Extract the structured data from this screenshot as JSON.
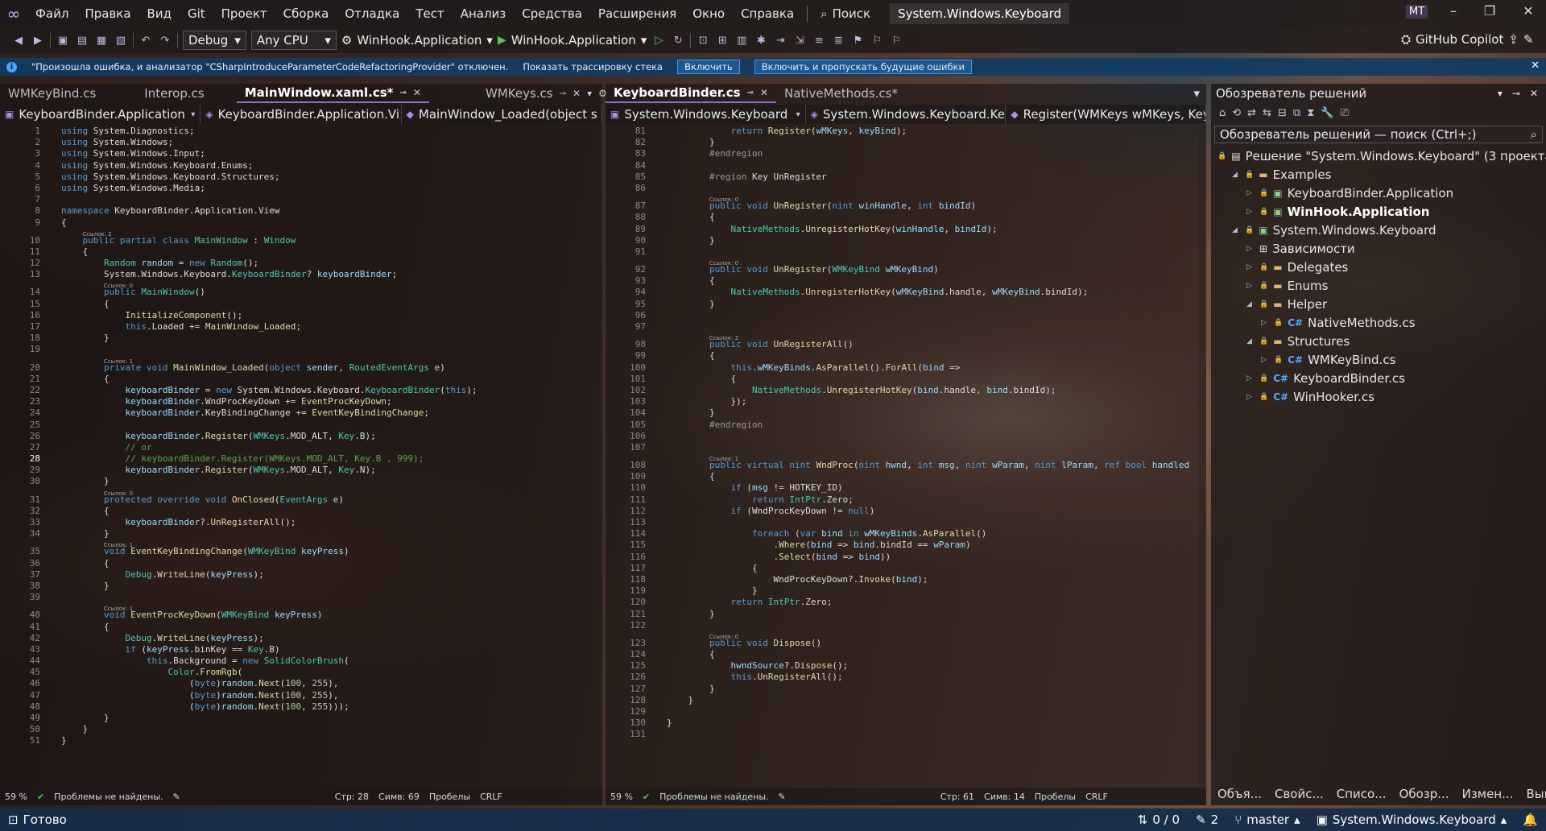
{
  "menu": {
    "items": [
      "Файл",
      "Правка",
      "Вид",
      "Git",
      "Проект",
      "Сборка",
      "Отладка",
      "Тест",
      "Анализ",
      "Средства",
      "Расширения",
      "Окно",
      "Справка"
    ],
    "search_label": "Поиск",
    "window_title": "System.Windows.Keyboard",
    "avatar": "MT"
  },
  "toolbar": {
    "config": "Debug",
    "platform": "Any CPU",
    "startup_project": "WinHook.Application",
    "run_target": "WinHook.Application",
    "copilot": "GitHub Copilot"
  },
  "infobar": {
    "message": "\"Произошла ошибка, и анализатор \"CSharpIntroduceParameterCodeRefactoringProvider\" отключен.",
    "show_stack": "Показать трассировку стека",
    "enable": "Включить",
    "enable_ignore": "Включить и пропускать будущие ошибки"
  },
  "left_pane": {
    "tabs": [
      "WMKeyBind.cs",
      "Interop.cs",
      "MainWindow.xaml.cs*",
      "WMKeys.cs"
    ],
    "nav": [
      "KeyboardBinder.Application",
      "KeyboardBinder.Application.Vi",
      "MainWindow_Loaded(object s"
    ],
    "status": {
      "zoom": "59 %",
      "problems": "Проблемы не найдены.",
      "line": "Стр: 28",
      "col": "Симв: 69",
      "spaces": "Пробелы",
      "eol": "CRLF"
    }
  },
  "right_pane": {
    "tabs": [
      "KeyboardBinder.cs",
      "NativeMethods.cs*"
    ],
    "nav": [
      "System.Windows.Keyboard",
      "System.Windows.Keyboard.Key",
      "Register(WMKeys wMKeys, Key"
    ],
    "status": {
      "zoom": "59 %",
      "problems": "Проблемы не найдены.",
      "line": "Стр: 61",
      "col": "Симв: 14",
      "spaces": "Пробелы",
      "eol": "CRLF"
    }
  },
  "solution_explorer": {
    "title": "Обозреватель решений",
    "search_placeholder": "Обозреватель решений — поиск (Ctrl+;)",
    "solution": "Решение \"System.Windows.Keyboard\" (3 проекта 3)",
    "nodes": [
      {
        "label": "Examples",
        "indent": 1,
        "kind": "folder",
        "arrow": "open"
      },
      {
        "label": "KeyboardBinder.Application",
        "indent": 2,
        "kind": "project",
        "arrow": "closed"
      },
      {
        "label": "WinHook.Application",
        "indent": 2,
        "kind": "project",
        "arrow": "closed",
        "bold": true
      },
      {
        "label": "System.Windows.Keyboard",
        "indent": 1,
        "kind": "project",
        "arrow": "open"
      },
      {
        "label": "Зависимости",
        "indent": 2,
        "kind": "deps",
        "arrow": "closed"
      },
      {
        "label": "Delegates",
        "indent": 2,
        "kind": "folder",
        "arrow": "closed"
      },
      {
        "label": "Enums",
        "indent": 2,
        "kind": "folder",
        "arrow": "closed"
      },
      {
        "label": "Helper",
        "indent": 2,
        "kind": "folder",
        "arrow": "open"
      },
      {
        "label": "NativeMethods.cs",
        "indent": 3,
        "kind": "cs",
        "arrow": "closed"
      },
      {
        "label": "Structures",
        "indent": 2,
        "kind": "folder",
        "arrow": "open"
      },
      {
        "label": "WMKeyBind.cs",
        "indent": 3,
        "kind": "cs",
        "arrow": "closed"
      },
      {
        "label": "KeyboardBinder.cs",
        "indent": 2,
        "kind": "cs",
        "arrow": "closed"
      },
      {
        "label": "WinHooker.cs",
        "indent": 2,
        "kind": "cs",
        "arrow": "closed"
      }
    ],
    "bottom_tabs": [
      "Объя...",
      "Свойс...",
      "Списо...",
      "Обозр...",
      "Измен...",
      "Вывод"
    ]
  },
  "statusbar": {
    "ready": "Готово",
    "changes": "0 / 0",
    "edits": "2",
    "branch": "master",
    "repo": "System.Windows.Keyboard"
  },
  "left_code": [
    {
      "n": "1",
      "h": "<span class='k'>using</span> System.Diagnostics;"
    },
    {
      "n": "2",
      "h": "<span class='k'>using</span> System.Windows;"
    },
    {
      "n": "3",
      "h": "<span class='k'>using</span> System.Windows.Input;"
    },
    {
      "n": "4",
      "h": "<span class='k'>using</span> System.Windows.Keyboard.Enums;"
    },
    {
      "n": "5",
      "h": "<span class='k'>using</span> System.Windows.Keyboard.Structures;"
    },
    {
      "n": "6",
      "h": "<span class='k'>using</span> System.Windows.Media;"
    },
    {
      "n": "7",
      "h": ""
    },
    {
      "n": "8",
      "h": "<span class='k'>namespace</span> KeyboardBinder.Application.View"
    },
    {
      "n": "9",
      "h": "{"
    },
    {
      "n": "10",
      "h": "    <span class='k'>public partial class</span> <span class='t'>MainWindow</span> : <span class='t'>Window</span>",
      "lens": "Ссылок: 2"
    },
    {
      "n": "11",
      "h": "    {"
    },
    {
      "n": "12",
      "h": "        <span class='t'>Random</span> <span class='p'>random</span> = <span class='k'>new</span> <span class='t'>Random</span>();"
    },
    {
      "n": "13",
      "h": "        System.Windows.Keyboard.<span class='t'>KeyboardBinder</span>? <span class='p'>keyboardBinder</span>;"
    },
    {
      "n": "14",
      "h": "        <span class='k'>public</span> <span class='t'>MainWindow</span>()",
      "lens": "Ссылок: 0"
    },
    {
      "n": "15",
      "h": "        {"
    },
    {
      "n": "16",
      "h": "            <span class='m'>InitializeComponent</span>();"
    },
    {
      "n": "17",
      "h": "            <span class='k'>this</span>.Loaded += <span class='m'>MainWindow_Loaded</span>;"
    },
    {
      "n": "18",
      "h": "        }"
    },
    {
      "n": "19",
      "h": ""
    },
    {
      "n": "20",
      "h": "        <span class='k'>private void</span> <span class='m'>MainWindow_Loaded</span>(<span class='k'>object</span> <span class='p'>sender</span>, <span class='t'>RoutedEventArgs</span> <span class='p'>e</span>)",
      "lens": "Ссылок: 1"
    },
    {
      "n": "21",
      "h": "        {"
    },
    {
      "n": "22",
      "h": "            <span class='p'>keyboardBinder</span> = <span class='k'>new</span> System.Windows.Keyboard.<span class='t'>KeyboardBinder</span>(<span class='k'>this</span>);"
    },
    {
      "n": "23",
      "h": "            <span class='p'>keyboardBinder</span>.WndProcKeyDown += <span class='m'>EventProcKeyDown</span>;"
    },
    {
      "n": "24",
      "h": "            <span class='p'>keyboardBinder</span>.KeyBindingChange += <span class='m'>EventKeyBindingChange</span>;"
    },
    {
      "n": "25",
      "h": ""
    },
    {
      "n": "26",
      "h": "            <span class='p'>keyboardBinder</span>.<span class='m'>Register</span>(<span class='t'>WMKeys</span>.MOD_ALT, <span class='t'>Key</span>.B);"
    },
    {
      "n": "27",
      "h": "            <span class='c'>// or</span>"
    },
    {
      "n": "28",
      "h": "            <span class='c'>// keyboardBinder.Register(WMKeys.MOD_ALT, Key.B , 999);</span>",
      "cur": true
    },
    {
      "n": "29",
      "h": "            <span class='p'>keyboardBinder</span>.<span class='m'>Register</span>(<span class='t'>WMKeys</span>.MOD_ALT, <span class='t'>Key</span>.N);"
    },
    {
      "n": "30",
      "h": "        }"
    },
    {
      "n": "31",
      "h": "        <span class='k'>protected override void</span> <span class='m'>OnClosed</span>(<span class='t'>EventArgs</span> <span class='p'>e</span>)",
      "lens": "Ссылок: 0"
    },
    {
      "n": "32",
      "h": "        {"
    },
    {
      "n": "33",
      "h": "            <span class='p'>keyboardBinder</span>?.<span class='m'>UnRegisterAll</span>();"
    },
    {
      "n": "34",
      "h": "        }"
    },
    {
      "n": "35",
      "h": "        <span class='k'>void</span> <span class='m'>EventKeyBindingChange</span>(<span class='t'>WMKeyBind</span> <span class='p'>keyPress</span>)",
      "lens": "Ссылок: 1"
    },
    {
      "n": "36",
      "h": "        {"
    },
    {
      "n": "37",
      "h": "            <span class='t'>Debug</span>.<span class='m'>WriteLine</span>(<span class='p'>keyPress</span>);"
    },
    {
      "n": "38",
      "h": "        }"
    },
    {
      "n": "39",
      "h": ""
    },
    {
      "n": "40",
      "h": "        <span class='k'>void</span> <span class='m'>EventProcKeyDown</span>(<span class='t'>WMKeyBind</span> <span class='p'>keyPress</span>)",
      "lens": "Ссылок: 1"
    },
    {
      "n": "41",
      "h": "        {"
    },
    {
      "n": "42",
      "h": "            <span class='t'>Debug</span>.<span class='m'>WriteLine</span>(<span class='p'>keyPress</span>);"
    },
    {
      "n": "43",
      "h": "            <span class='k'>if</span> (<span class='p'>keyPress</span>.binKey == <span class='t'>Key</span>.B)"
    },
    {
      "n": "44",
      "h": "                <span class='k'>this</span>.Background = <span class='k'>new</span> <span class='t'>SolidColorBrush</span>("
    },
    {
      "n": "45",
      "h": "                    <span class='t'>Color</span>.<span class='m'>FromRgb</span>("
    },
    {
      "n": "46",
      "h": "                        (<span class='k'>byte</span>)<span class='p'>random</span>.<span class='m'>Next</span>(<span class='n'>100</span>, <span class='n'>255</span>),"
    },
    {
      "n": "47",
      "h": "                        (<span class='k'>byte</span>)<span class='p'>random</span>.<span class='m'>Next</span>(<span class='n'>100</span>, <span class='n'>255</span>),"
    },
    {
      "n": "48",
      "h": "                        (<span class='k'>byte</span>)<span class='p'>random</span>.<span class='m'>Next</span>(<span class='n'>100</span>, <span class='n'>255</span>)));"
    },
    {
      "n": "49",
      "h": "        }"
    },
    {
      "n": "50",
      "h": "    }"
    },
    {
      "n": "51",
      "h": "}"
    }
  ],
  "right_code": [
    {
      "n": "81",
      "h": "            <span class='k'>return</span> <span class='m'>Register</span>(<span class='p'>wMKeys</span>, <span class='p'>keyBind</span>);"
    },
    {
      "n": "82",
      "h": "        }"
    },
    {
      "n": "83",
      "h": "        <span class='pp'>#endregion</span>"
    },
    {
      "n": "84",
      "h": ""
    },
    {
      "n": "85",
      "h": "        <span class='pp'>#region</span> Key UnRegister"
    },
    {
      "n": "86",
      "h": ""
    },
    {
      "n": "87",
      "h": "        <span class='k'>public void</span> <span class='m'>UnRegister</span>(<span class='k'>nint</span> <span class='p'>winHandle</span>, <span class='k'>int</span> <span class='p'>bindId</span>)",
      "lens": "Ссылок: 0"
    },
    {
      "n": "88",
      "h": "        {"
    },
    {
      "n": "89",
      "h": "            <span class='t'>NativeMethods</span>.<span class='m'>UnregisterHotKey</span>(<span class='p'>winHandle</span>, <span class='p'>bindId</span>);"
    },
    {
      "n": "90",
      "h": "        }"
    },
    {
      "n": "91",
      "h": ""
    },
    {
      "n": "92",
      "h": "        <span class='k'>public void</span> <span class='m'>UnRegister</span>(<span class='t'>WMKeyBind</span> <span class='p'>wMKeyBind</span>)",
      "lens": "Ссылок: 0"
    },
    {
      "n": "93",
      "h": "        {"
    },
    {
      "n": "94",
      "h": "            <span class='t'>NativeMethods</span>.<span class='m'>UnregisterHotKey</span>(<span class='p'>wMKeyBind</span>.handle, <span class='p'>wMKeyBind</span>.bindId);"
    },
    {
      "n": "95",
      "h": "        }"
    },
    {
      "n": "96",
      "h": ""
    },
    {
      "n": "97",
      "h": ""
    },
    {
      "n": "98",
      "h": "        <span class='k'>public void</span> <span class='m'>UnRegisterAll</span>()",
      "lens": "Ссылок: 2"
    },
    {
      "n": "99",
      "h": "        {"
    },
    {
      "n": "100",
      "h": "            <span class='k'>this</span>.<span class='p'>wMKeyBinds</span>.<span class='m'>AsParallel</span>().<span class='m'>ForAll</span>(<span class='p'>bind</span> =>"
    },
    {
      "n": "101",
      "h": "            {"
    },
    {
      "n": "102",
      "h": "                <span class='t'>NativeMethods</span>.<span class='m'>UnregisterHotKey</span>(<span class='p'>bind</span>.handle, <span class='p'>bind</span>.bindId);"
    },
    {
      "n": "103",
      "h": "            });"
    },
    {
      "n": "104",
      "h": "        }"
    },
    {
      "n": "105",
      "h": "        <span class='pp'>#endregion</span>"
    },
    {
      "n": "106",
      "h": ""
    },
    {
      "n": "107",
      "h": ""
    },
    {
      "n": "108",
      "h": "        <span class='k'>public virtual nint</span> <span class='m'>WndProc</span>(<span class='k'>nint</span> <span class='p'>hwnd</span>, <span class='k'>int</span> <span class='p'>msg</span>, <span class='k'>nint</span> <span class='p'>wParam</span>, <span class='k'>nint</span> <span class='p'>lParam</span>, <span class='k'>ref bool</span> <span class='p'>handled</span>",
      "lens": "Ссылок: 1"
    },
    {
      "n": "109",
      "h": "        {"
    },
    {
      "n": "110",
      "h": "            <span class='k'>if</span> (<span class='p'>msg</span> != HOTKEY_ID)"
    },
    {
      "n": "111",
      "h": "                <span class='k'>return</span> <span class='t'>IntPtr</span>.Zero;"
    },
    {
      "n": "112",
      "h": "            <span class='k'>if</span> (WndProcKeyDown != <span class='k'>null</span>)"
    },
    {
      "n": "113",
      "h": ""
    },
    {
      "n": "114",
      "h": "                <span class='k'>foreach</span> (<span class='k'>var</span> <span class='p'>bind</span> <span class='k'>in</span> <span class='p'>wMKeyBinds</span>.<span class='m'>AsParallel</span>()"
    },
    {
      "n": "115",
      "h": "                    .<span class='m'>Where</span>(<span class='p'>bind</span> => <span class='p'>bind</span>.bindId == <span class='p'>wParam</span>)"
    },
    {
      "n": "116",
      "h": "                    .<span class='m'>Select</span>(<span class='p'>bind</span> => <span class='p'>bind</span>))"
    },
    {
      "n": "117",
      "h": "                {"
    },
    {
      "n": "118",
      "h": "                    WndProcKeyDown?.<span class='m'>Invoke</span>(<span class='p'>bind</span>);"
    },
    {
      "n": "119",
      "h": "                }"
    },
    {
      "n": "120",
      "h": "            <span class='k'>return</span> <span class='t'>IntPtr</span>.Zero;"
    },
    {
      "n": "121",
      "h": "        }"
    },
    {
      "n": "122",
      "h": ""
    },
    {
      "n": "123",
      "h": "        <span class='k'>public void</span> <span class='m'>Dispose</span>()",
      "lens": "Ссылок: 0"
    },
    {
      "n": "124",
      "h": "        {"
    },
    {
      "n": "125",
      "h": "            <span class='p'>hwndSource</span>?.<span class='m'>Dispose</span>();"
    },
    {
      "n": "126",
      "h": "            <span class='k'>this</span>.<span class='m'>UnRegisterAll</span>();"
    },
    {
      "n": "127",
      "h": "        }"
    },
    {
      "n": "128",
      "h": "    }"
    },
    {
      "n": "129",
      "h": ""
    },
    {
      "n": "130",
      "h": "}"
    },
    {
      "n": "131",
      "h": ""
    }
  ]
}
